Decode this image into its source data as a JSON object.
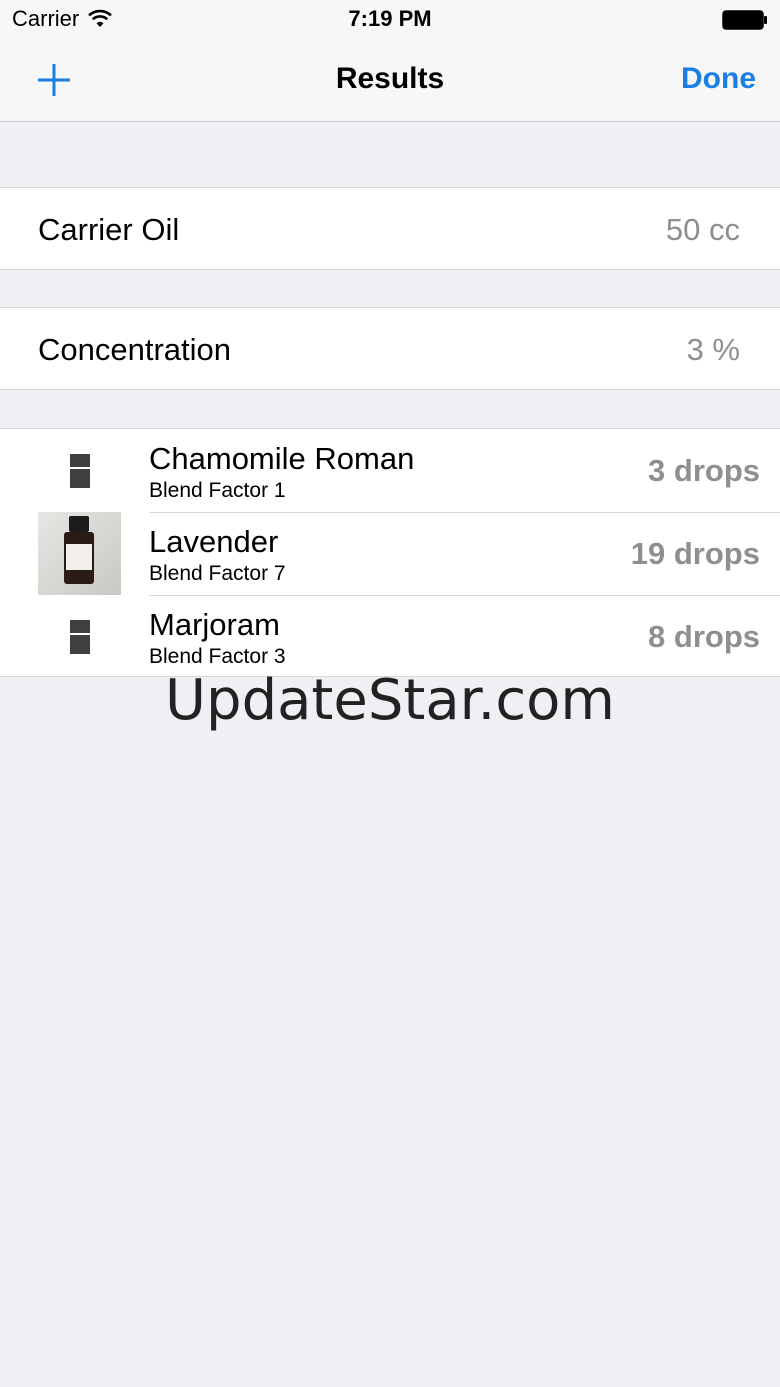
{
  "status_bar": {
    "carrier": "Carrier",
    "time": "7:19 PM"
  },
  "nav": {
    "title": "Results",
    "done_label": "Done",
    "add_icon": "plus-icon",
    "accent_color": "#1a7ee6"
  },
  "settings": {
    "carrier_oil": {
      "label": "Carrier Oil",
      "value": "50 cc"
    },
    "concentration": {
      "label": "Concentration",
      "value": "3 %"
    }
  },
  "oils": [
    {
      "name": "Chamomile Roman",
      "factor": "Blend Factor 1",
      "drops": "3 drops",
      "thumbnail": "bottle-placeholder-icon"
    },
    {
      "name": "Lavender",
      "factor": "Blend Factor 7",
      "drops": "19 drops",
      "thumbnail": "bottle-photo"
    },
    {
      "name": "Marjoram",
      "factor": "Blend Factor 3",
      "drops": "8 drops",
      "thumbnail": "bottle-placeholder-icon"
    }
  ],
  "watermark": "UpdateStar.com"
}
